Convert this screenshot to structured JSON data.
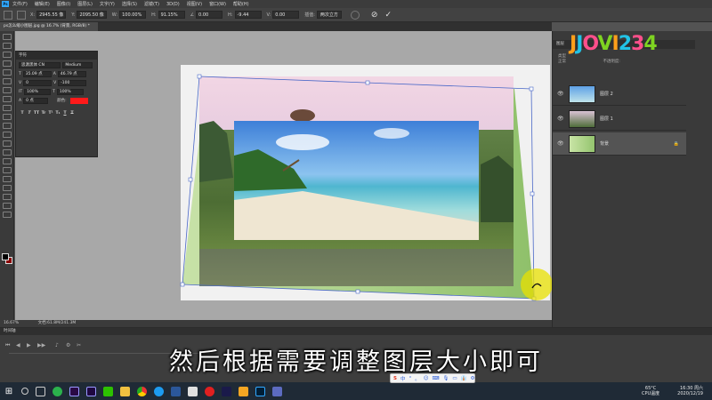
{
  "menubar": {
    "items": [
      "文件(F)",
      "编辑(E)",
      "图像(I)",
      "图层(L)",
      "文字(Y)",
      "选择(S)",
      "滤镜(T)",
      "3D(D)",
      "视图(V)",
      "窗口(W)",
      "帮助(H)"
    ]
  },
  "options": {
    "x_label": "X:",
    "x_value": "2945.55 像",
    "y_label": "Y:",
    "y_value": "2095.50 像",
    "w_label": "W:",
    "w_value": "100.00%",
    "h_label": "H:",
    "h_value": "91.15%",
    "angle_label": "∠",
    "angle_value": "0.00",
    "hskew_label": "H:",
    "hskew_value": "-9.44",
    "vskew_label": "V:",
    "vskew_value": "0.00",
    "interp_label": "插值:",
    "interp_value": "两次立方",
    "cancel_icon": "cancel-icon",
    "commit_icon": "check-icon"
  },
  "document": {
    "tab_title": "ps怎么缩小图层.jpg @ 16.7% (背景, RGB/8) *"
  },
  "char_panel": {
    "title": "字符",
    "font_family": "思源黑体 CN",
    "font_style": "Medium",
    "size": "35.09 点",
    "leading": "46.79 点",
    "kerning": "0",
    "tracking": "-100",
    "scale_v": "100%",
    "scale_h": "100%",
    "baseline": "0 点",
    "color_label": "颜色:",
    "color": "#ff1a1a",
    "style_buttons": [
      "T",
      "T",
      "TT",
      "Tr",
      "T¹",
      "T₁",
      "T",
      "T"
    ]
  },
  "status": {
    "zoom": "16.67%",
    "doc_size": "文档:61.8M/241.3M"
  },
  "timeline": {
    "title": "时间轴"
  },
  "layers": {
    "header": "图层",
    "kind": "类型",
    "mode": "正常",
    "opacity_label": "不透明度:",
    "items": [
      {
        "name": "图层 2",
        "active": false
      },
      {
        "name": "图层 1",
        "active": false
      },
      {
        "name": "背景",
        "active": true,
        "locked": true
      }
    ]
  },
  "logo": {
    "text_parts": [
      "J",
      "J",
      "O",
      "V",
      "I",
      "2",
      "3",
      "4"
    ]
  },
  "subtitle": "然后根据需要调整图层大小即可",
  "ime": {
    "items": [
      "S",
      "中",
      "°",
      "。",
      "☺",
      "⌨",
      "🎙",
      "▭",
      "👔",
      "⚙"
    ]
  },
  "tray": {
    "temp": "65°C",
    "temp_label": "CPU温度",
    "time": "16:30 周六",
    "date": "2020/12/19"
  }
}
